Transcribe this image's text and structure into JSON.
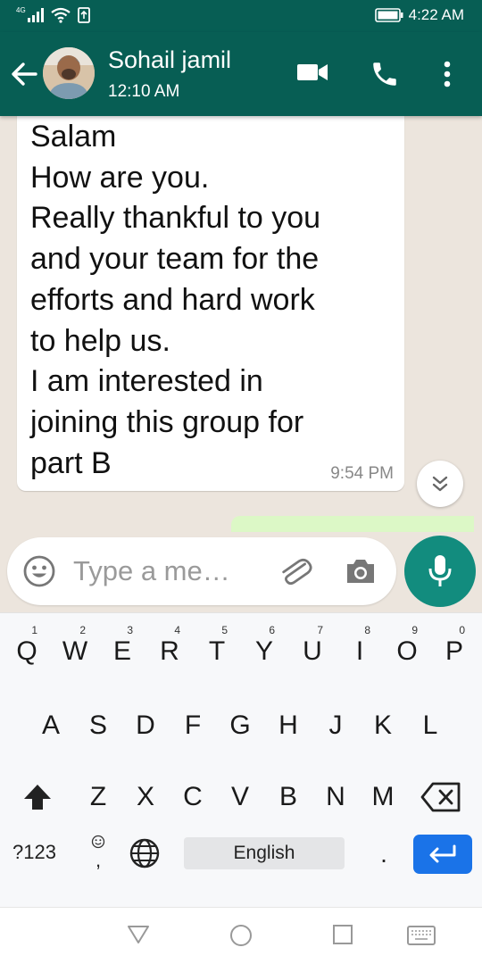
{
  "status_bar": {
    "network": "4G",
    "time": "4:22 AM"
  },
  "header": {
    "contact_name": "Sohail jamil",
    "last_seen": "12:10 AM",
    "icons": [
      "back-arrow-icon",
      "video-call-icon",
      "voice-call-icon",
      "more-options-icon"
    ]
  },
  "chat": {
    "incoming_message": {
      "text": "Salam\nHow are you.\nReally thankful to you\nand your team for the\nefforts and hard work\nto help us.\nI am interested in\njoining this group for\npart B",
      "time": "9:54 PM"
    }
  },
  "input_bar": {
    "placeholder": "Type a me…",
    "value": ""
  },
  "keyboard": {
    "row1": [
      {
        "key": "Q",
        "hint": "1"
      },
      {
        "key": "W",
        "hint": "2"
      },
      {
        "key": "E",
        "hint": "3"
      },
      {
        "key": "R",
        "hint": "4"
      },
      {
        "key": "T",
        "hint": "5"
      },
      {
        "key": "Y",
        "hint": "6"
      },
      {
        "key": "U",
        "hint": "7"
      },
      {
        "key": "I",
        "hint": "8"
      },
      {
        "key": "O",
        "hint": "9"
      },
      {
        "key": "P",
        "hint": "0"
      }
    ],
    "row2": [
      "A",
      "S",
      "D",
      "F",
      "G",
      "H",
      "J",
      "K",
      "L"
    ],
    "row3": [
      "Z",
      "X",
      "C",
      "V",
      "B",
      "N",
      "M"
    ],
    "symbols_label": "?123",
    "comma_label": ",",
    "period_label": ".",
    "space_label": "English"
  },
  "colors": {
    "header": "#075e54",
    "accent": "#128c7e",
    "outgoing_bubble": "#dcf8c6",
    "chat_background": "#ece5dd",
    "enter_key": "#1a73e8"
  }
}
